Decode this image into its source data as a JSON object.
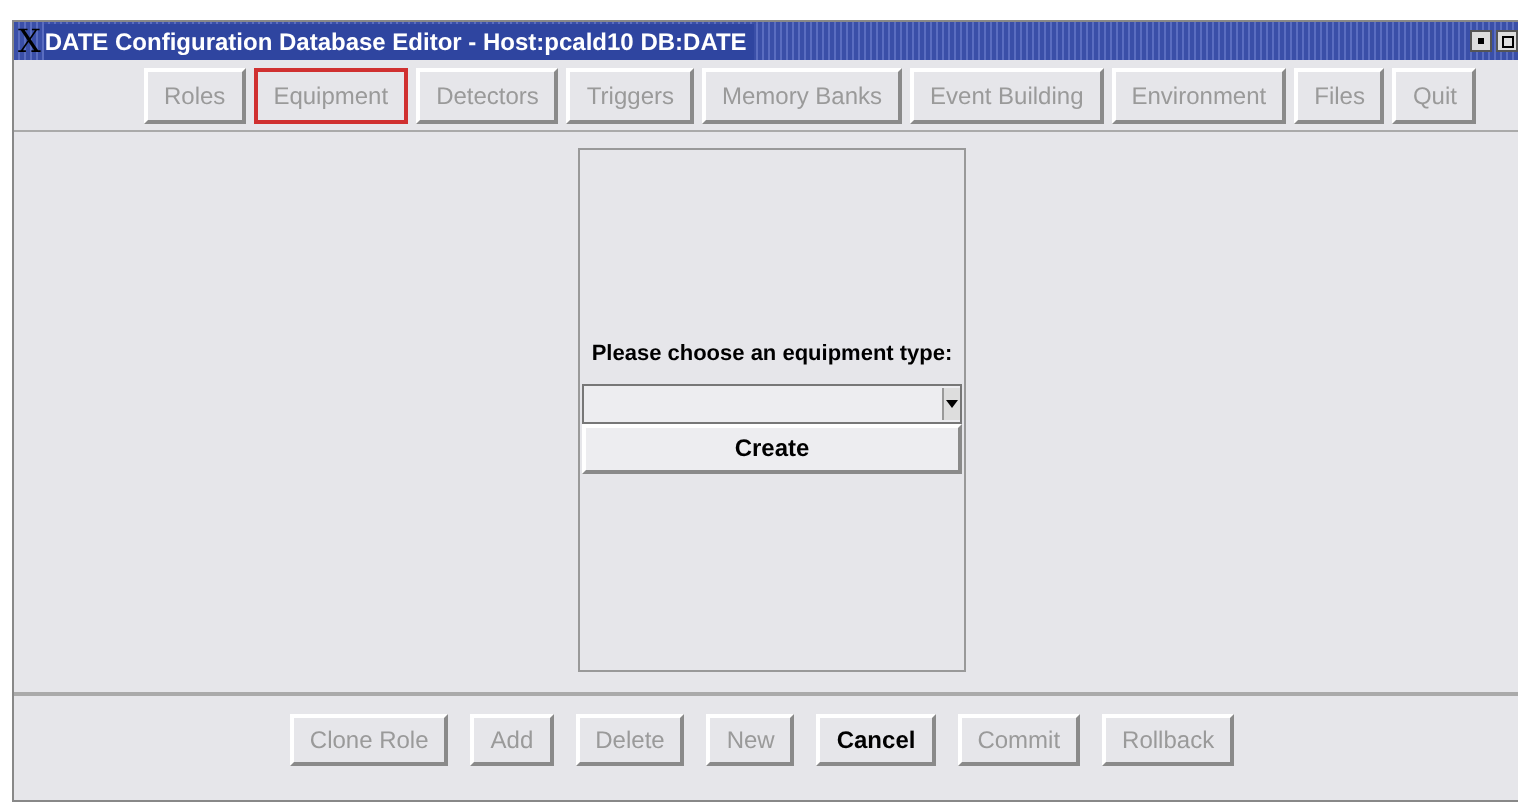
{
  "window": {
    "title": "DATE Configuration Database Editor - Host:pcald10 DB:DATE",
    "logo": "X"
  },
  "tabs": [
    {
      "label": "Roles",
      "selected": false,
      "disabled": true
    },
    {
      "label": "Equipment",
      "selected": true,
      "disabled": true
    },
    {
      "label": "Detectors",
      "selected": false,
      "disabled": true
    },
    {
      "label": "Triggers",
      "selected": false,
      "disabled": true
    },
    {
      "label": "Memory Banks",
      "selected": false,
      "disabled": true
    },
    {
      "label": "Event Building",
      "selected": false,
      "disabled": true
    },
    {
      "label": "Environment",
      "selected": false,
      "disabled": true
    },
    {
      "label": "Files",
      "selected": false,
      "disabled": true
    },
    {
      "label": "Quit",
      "selected": false,
      "disabled": true
    }
  ],
  "panel": {
    "prompt": "Please choose an equipment type:",
    "create_button": "Create"
  },
  "buttons": [
    {
      "label": "Clone Role",
      "disabled": true
    },
    {
      "label": "Add",
      "disabled": true
    },
    {
      "label": "Delete",
      "disabled": true
    },
    {
      "label": "New",
      "disabled": true
    },
    {
      "label": "Cancel",
      "disabled": false
    },
    {
      "label": "Commit",
      "disabled": true
    },
    {
      "label": "Rollback",
      "disabled": true
    }
  ]
}
